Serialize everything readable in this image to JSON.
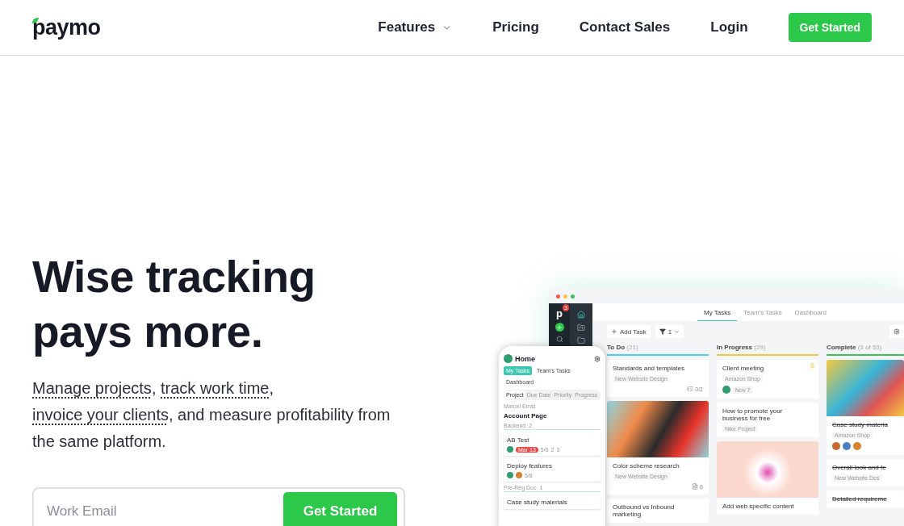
{
  "nav": {
    "logo": "paymo",
    "links": [
      {
        "label": "Features",
        "dropdown": true
      },
      {
        "label": "Pricing",
        "dropdown": false
      },
      {
        "label": "Contact Sales",
        "dropdown": false
      },
      {
        "label": "Login",
        "dropdown": false
      }
    ],
    "cta": "Get Started"
  },
  "hero": {
    "title": [
      "Wise tracking",
      "pays more."
    ],
    "description": [
      {
        "kind": "link",
        "text": "Manage projects"
      },
      {
        "kind": "plain",
        "text": ", "
      },
      {
        "kind": "link",
        "text": "track work time"
      },
      {
        "kind": "plain",
        "text": ", "
      },
      {
        "kind": "link",
        "text": "invoice your clients"
      },
      {
        "kind": "plain",
        "text": ", and measure profitability from the same platform."
      }
    ],
    "email": {
      "placeholder": "Work Email",
      "button": "Get Started"
    }
  },
  "app": {
    "logo": "p",
    "badge": "3",
    "tabs": [
      {
        "label": "My Tasks",
        "selected": true
      },
      {
        "label": "Team's Tasks",
        "selected": false
      },
      {
        "label": "Dashboard",
        "selected": false
      }
    ],
    "add_task": "Add Task",
    "filter_count": "1",
    "columns": [
      {
        "name": "To Do",
        "count": "(21)",
        "color": "#4dd0e8",
        "cards": [
          {
            "kind": "text",
            "title": "Standards and templates",
            "project": "New Website Design",
            "meta": {
              "kind": "subtasks",
              "text": "0/2"
            },
            "done": false
          },
          {
            "kind": "photo",
            "title": "Color scheme research",
            "project": "New Website Design",
            "meta": {
              "kind": "files",
              "text": "6"
            },
            "done": false
          },
          {
            "kind": "text",
            "title": "Outbound vs Inbound marketing",
            "done": false
          }
        ]
      },
      {
        "name": "In Progress",
        "count": "(29)",
        "color": "#f5c842",
        "cards": [
          {
            "kind": "text",
            "title": "Client meeting",
            "project": "Amazon Shop",
            "pinned": true,
            "avatars": [
              {
                "color": "#2f9e6e"
              }
            ],
            "date": "Nov 7",
            "done": false
          },
          {
            "kind": "text",
            "title": "How to promote your business for free",
            "project": "Nike Project",
            "done": false
          },
          {
            "kind": "photo",
            "title": "Add web specific content",
            "done": false
          }
        ]
      },
      {
        "name": "Complete",
        "count": "(3 of 53)",
        "color": "#3cc35a",
        "cards": [
          {
            "kind": "photo",
            "title": "Case study materia",
            "project": "Amazon Shop",
            "avatars": [
              {
                "color": "#c8692f"
              },
              {
                "color": "#4a7fc1"
              },
              {
                "color": "#d9822b"
              }
            ],
            "done": true
          },
          {
            "kind": "text",
            "title": "Overall look and fe",
            "project": "New Website Des",
            "done": true
          },
          {
            "kind": "text",
            "title": "Detailed requireme",
            "done": true
          }
        ]
      }
    ]
  },
  "phone": {
    "title": "Home",
    "tabs": [
      {
        "label": "My Tasks",
        "selected": true
      },
      {
        "label": "Team's Tasks",
        "selected": false
      },
      {
        "label": "Dashboard",
        "selected": false
      }
    ],
    "filters": [
      {
        "label": "Project",
        "selected": true
      },
      {
        "label": "Due Date",
        "selected": false
      },
      {
        "label": "Priority",
        "selected": false
      },
      {
        "label": "Progress",
        "selected": false
      }
    ],
    "owner": "Marcel Ernst",
    "project": "Account Page",
    "groups": [
      {
        "name": "Backend",
        "count": "2",
        "tasks": [
          {
            "title": "AB Test",
            "due": "Mar 13",
            "avatars": [
              {
                "color": "#2f9e6e"
              }
            ],
            "stats": [
              "5/6",
              "2",
              "3"
            ]
          },
          {
            "title": "Deploy features",
            "avatars": [
              {
                "color": "#2f9e6e"
              },
              {
                "color": "#d9822b"
              }
            ],
            "stats": [
              "5/8"
            ]
          }
        ]
      },
      {
        "name": "Pre-Reg Doc",
        "count": "1",
        "tasks": [
          {
            "title": "Case study materials"
          }
        ]
      }
    ]
  }
}
